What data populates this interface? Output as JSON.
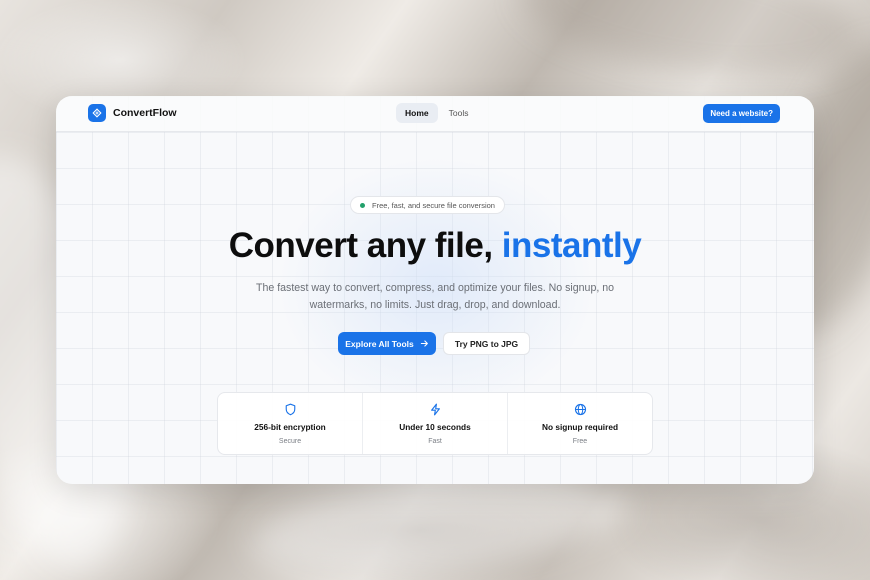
{
  "brand": {
    "name": "ConvertFlow"
  },
  "nav": {
    "links": [
      {
        "label": "Home",
        "active": true
      },
      {
        "label": "Tools",
        "active": false
      }
    ],
    "cta_label": "Need a website?"
  },
  "hero": {
    "pill_text": "Free, fast, and secure file conversion",
    "headline_main": "Convert any file,",
    "headline_accent": "instantly",
    "subtext": "The fastest way to convert, compress, and optimize your files. No signup, no watermarks, no limits. Just drag, drop, and download.",
    "primary_button": "Explore All Tools",
    "secondary_button": "Try PNG to JPG"
  },
  "features": [
    {
      "icon": "shield-icon",
      "title": "256-bit encryption",
      "subtitle": "Secure"
    },
    {
      "icon": "lightning-icon",
      "title": "Under 10 seconds",
      "subtitle": "Fast"
    },
    {
      "icon": "globe-icon",
      "title": "No signup required",
      "subtitle": "Free"
    }
  ],
  "colors": {
    "accent": "#1a73e8",
    "status_dot": "#22a06b"
  }
}
